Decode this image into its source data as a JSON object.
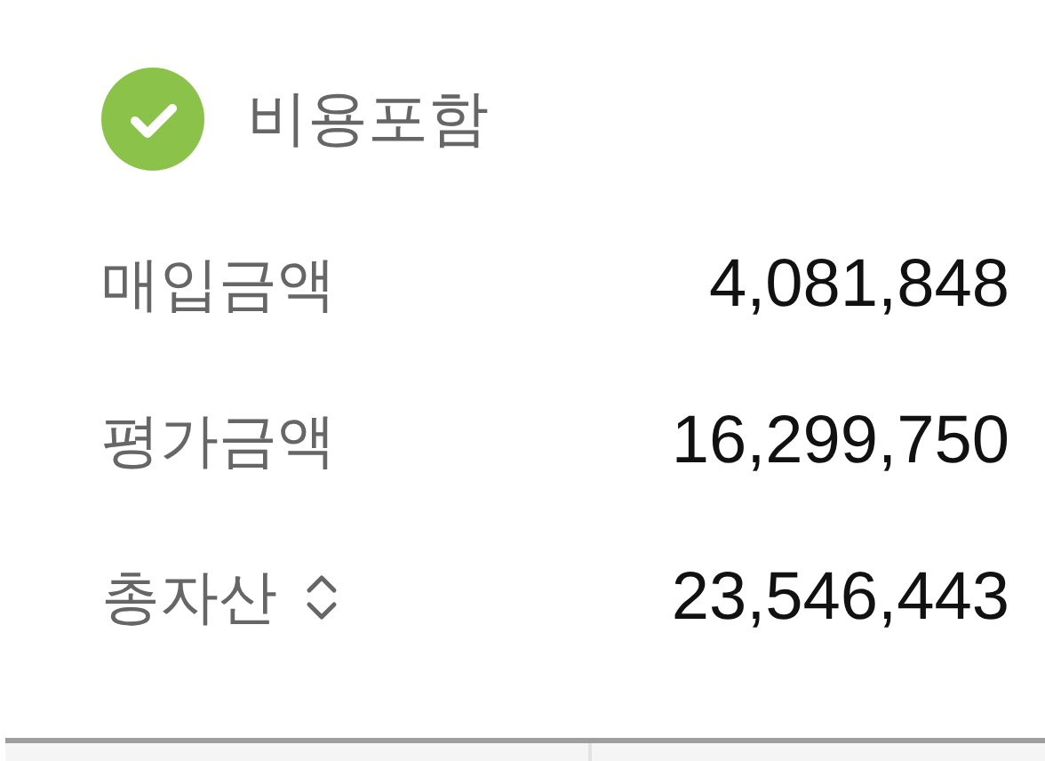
{
  "include_fees": {
    "label": "비용포함",
    "checked": true
  },
  "rows": [
    {
      "kind": "plain",
      "label": "매입금액",
      "value": "4,081,848"
    },
    {
      "kind": "plain",
      "label": "평가금액",
      "value": "16,299,750"
    },
    {
      "kind": "sortable",
      "label": "총자산",
      "value": "23,546,443"
    }
  ]
}
